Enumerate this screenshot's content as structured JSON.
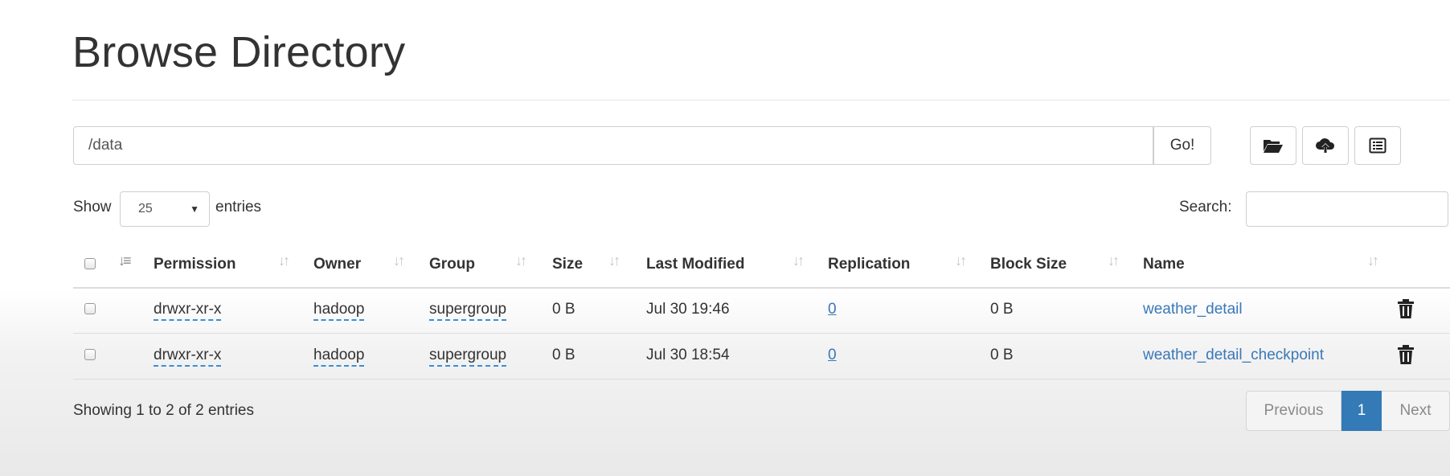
{
  "page": {
    "title": "Browse Directory"
  },
  "pathbar": {
    "value": "/data",
    "go_label": "Go!"
  },
  "toolbar": {
    "icons": [
      "folder-open-icon",
      "cloud-upload-icon",
      "list-icon"
    ]
  },
  "length_control": {
    "show_label": "Show",
    "selected": "25",
    "entries_label": "entries"
  },
  "search": {
    "label": "Search:",
    "value": ""
  },
  "table": {
    "columns": [
      "Permission",
      "Owner",
      "Group",
      "Size",
      "Last Modified",
      "Replication",
      "Block Size",
      "Name"
    ],
    "rows": [
      {
        "permission": "drwxr-xr-x",
        "owner": "hadoop",
        "group": "supergroup",
        "size": "0 B",
        "modified": "Jul 30 19:46",
        "replication": "0",
        "block_size": "0 B",
        "name": "weather_detail"
      },
      {
        "permission": "drwxr-xr-x",
        "owner": "hadoop",
        "group": "supergroup",
        "size": "0 B",
        "modified": "Jul 30 18:54",
        "replication": "0",
        "block_size": "0 B",
        "name": "weather_detail_checkpoint"
      }
    ]
  },
  "footer": {
    "info": "Showing 1 to 2 of 2 entries",
    "prev_label": "Previous",
    "current_page": "1",
    "next_label": "Next"
  },
  "colors": {
    "link": "#3a78b8",
    "active_page": "#337ab7"
  }
}
